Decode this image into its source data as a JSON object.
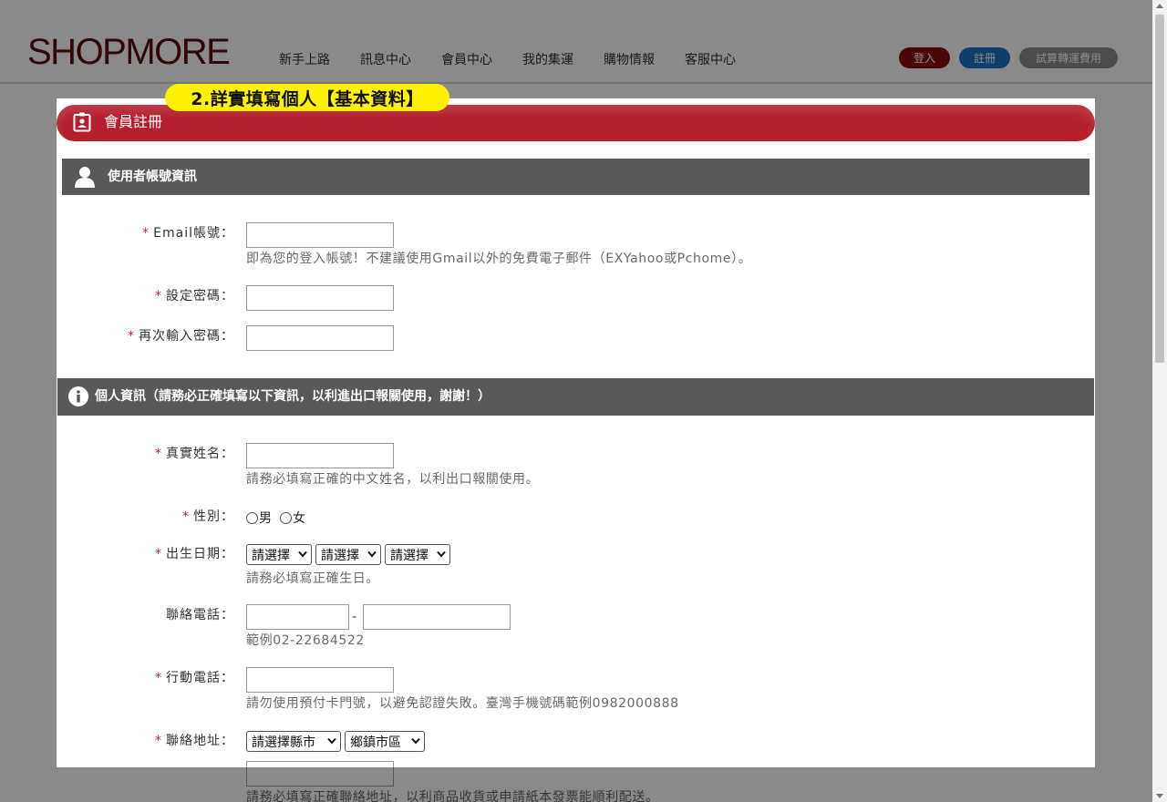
{
  "header": {
    "logo": "SHOPMORE",
    "nav": [
      "新手上路",
      "訊息中心",
      "會員中心",
      "我的集運",
      "購物情報",
      "客服中心"
    ],
    "login": "登入",
    "register": "註冊",
    "calc": "試算轉運費用"
  },
  "callout": "2.詳實填寫個人【基本資料】",
  "form": {
    "title": "會員註冊",
    "section1": {
      "title": "使用者帳號資訊",
      "email_label": "Email帳號：",
      "email_hint": "即為您的登入帳號！不建議使用Gmail以外的免費電子郵件（EXYahoo或Pchome）。",
      "password_label": "設定密碼：",
      "password2_label": "再次輸入密碼："
    },
    "section2": {
      "title": "個人資訊（請務必正確填寫以下資訊，以利進出口報關使用，謝謝！）",
      "name_label": "真實姓名：",
      "name_hint": "請務必填寫正確的中文姓名，以利出口報關使用。",
      "gender_label": "性別：",
      "gender_male": "男",
      "gender_female": "女",
      "birth_label": "出生日期：",
      "birth_year": "請選擇",
      "birth_month": "請選擇",
      "birth_day": "請選擇",
      "birth_hint": "請務必填寫正確生日。",
      "phone_label": "聯絡電話：",
      "phone_dash": "-",
      "phone_hint": "範例02-22684522",
      "mobile_label": "行動電話：",
      "mobile_hint": "請勿使用預付卡門號，以避免認證失敗。臺灣手機號碼範例0982000888",
      "address_label": "聯絡地址：",
      "address_city": "請選擇縣市",
      "address_district": "鄉鎮市區",
      "address_hint": "請務必填寫正確聯絡地址，以利商品收貨或申請紙本發票能順利配送。"
    }
  },
  "required_mark": "*"
}
